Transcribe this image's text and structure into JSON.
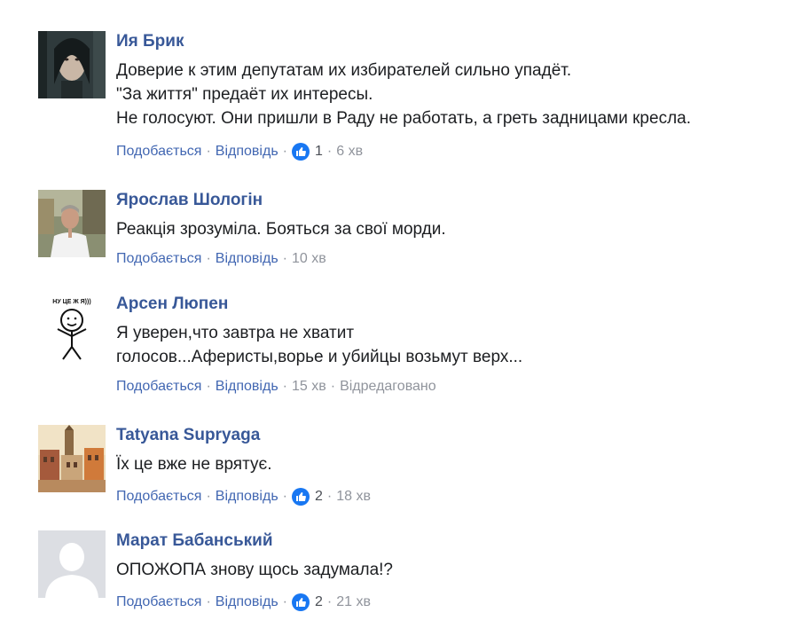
{
  "action_labels": {
    "like": "Подобається",
    "reply": "Відповідь",
    "separator": "·"
  },
  "comments": [
    {
      "author": "Ия Брик",
      "lines": [
        "Доверие к этим депутатам их избирателей сильно упадёт.",
        "\"За життя\" предаёт их интересы.",
        "Не голосуют. Они пришли в Раду не работать, а греть задницами кресла."
      ],
      "likes": "1",
      "time": "6 хв",
      "edited": ""
    },
    {
      "author": "Ярослав Шологін",
      "lines": [
        "Реакція зрозуміла. Бояться за свої морди."
      ],
      "likes": "",
      "time": "10 хв",
      "edited": ""
    },
    {
      "author": "Арсен Люпен",
      "avatar_caption": "НУ ЦЕ Ж Я)))",
      "lines": [
        "Я уверен,что завтра не хватит",
        "голосов...Аферисты,ворье и убийцы возьмут верх..."
      ],
      "likes": "",
      "time": "15 хв",
      "edited": "Відредаговано"
    },
    {
      "author": "Tatyana Supryaga",
      "lines": [
        "Їх це вже не врятує."
      ],
      "likes": "2",
      "time": "18 хв",
      "edited": ""
    },
    {
      "author": "Марат Бабанський",
      "lines": [
        "ОПОЖОПА знову щось задумала!?"
      ],
      "likes": "2",
      "time": "21 хв",
      "edited": ""
    }
  ],
  "colors": {
    "author": "#385898",
    "link": "#4267b2",
    "meta": "#90949c",
    "text": "#1c1e21",
    "like_badge": "#1877f2"
  },
  "icons": {
    "like_badge": "thumbs-up-icon"
  }
}
